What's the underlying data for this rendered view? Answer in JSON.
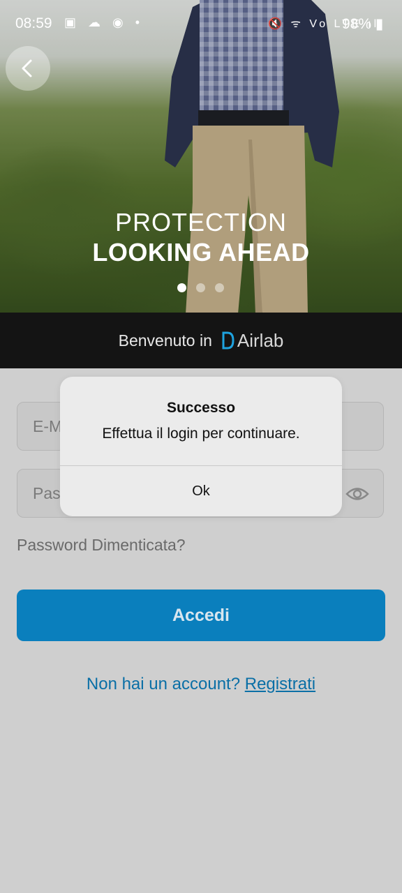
{
  "status": {
    "time": "08:59",
    "battery": "98%",
    "left_icons": "▣ ☁ ◉ •",
    "right_icons": "🔇 ᯤ Vo LTE ıl"
  },
  "hero": {
    "line1": "PROTECTION",
    "line2": "LOOKING AHEAD",
    "slides_total": 3,
    "active_slide": 1
  },
  "welcome": {
    "text": "Benvenuto in",
    "brand": "Airlab"
  },
  "form": {
    "email_placeholder": "E-Mail",
    "password_placeholder": "Password",
    "forgot_label": "Password Dimenticata?",
    "login_label": "Accedi",
    "signup_prompt": "Non hai un account?",
    "signup_link": "Registrati"
  },
  "dialog": {
    "title": "Successo",
    "message": "Effettua il login per continuare.",
    "ok_label": "Ok"
  },
  "colors": {
    "accent": "#0a7fbd",
    "link": "#0a6fa6",
    "welcome_bar": "#141414"
  }
}
